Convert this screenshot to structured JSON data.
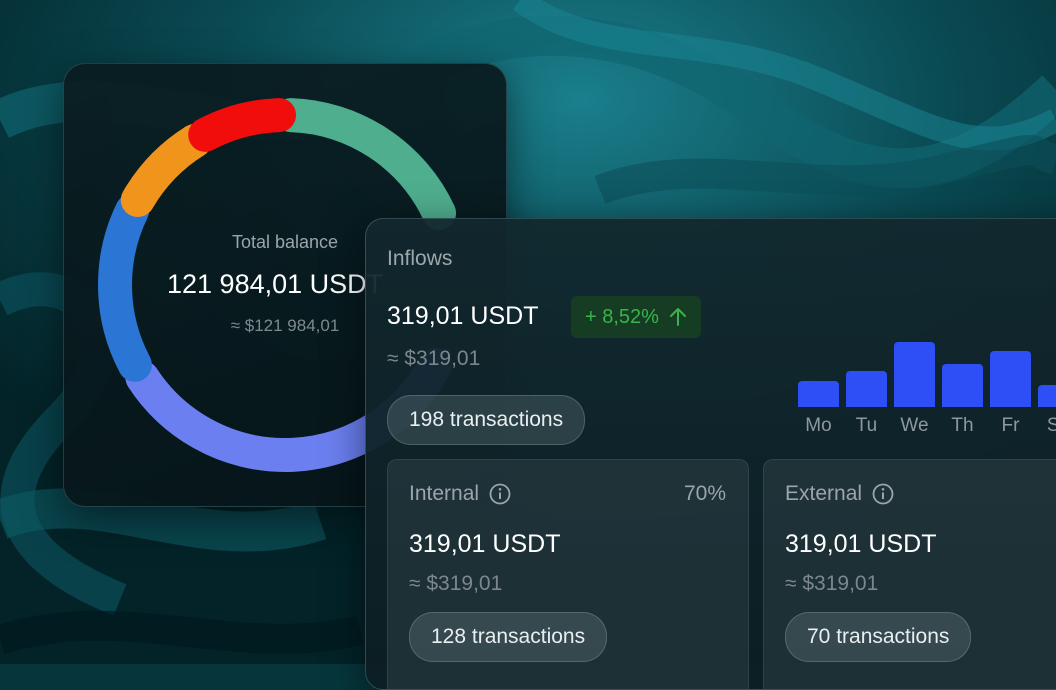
{
  "balance": {
    "label": "Total balance",
    "value": "121 984,01 USDT",
    "approx": "≈ $121 984,01",
    "segments": [
      {
        "name": "green",
        "color": "#4fae8e",
        "start": 2,
        "end": 65
      },
      {
        "name": "periwinkle",
        "color": "#6b7ff0",
        "start": 118,
        "end": 237
      },
      {
        "name": "blue",
        "color": "#2b76d4",
        "start": 242,
        "end": 296
      },
      {
        "name": "orange",
        "color": "#f0941c",
        "start": 300,
        "end": 328
      },
      {
        "name": "red",
        "color": "#f20d0d",
        "start": 332,
        "end": 358
      }
    ]
  },
  "inflows": {
    "title": "Inflows",
    "value": "319,01 USDT",
    "change": "+ 8,52%",
    "change_color": "#38b44a",
    "approx": "≈ $319,01",
    "transactions": "198 transactions",
    "bar_color": "#2d4ff5",
    "days": [
      {
        "label": "Mo",
        "value": 26
      },
      {
        "label": "Tu",
        "value": 36
      },
      {
        "label": "We",
        "value": 65
      },
      {
        "label": "Th",
        "value": 43
      },
      {
        "label": "Fr",
        "value": 56
      },
      {
        "label": "Sa",
        "value": 22
      }
    ]
  },
  "internal": {
    "title": "Internal",
    "info_icon": "info-icon",
    "percent": "70%",
    "value": "319,01 USDT",
    "approx": "≈ $319,01",
    "transactions": "128 transactions"
  },
  "external": {
    "title": "External",
    "info_icon": "info-icon",
    "value": "319,01 USDT",
    "approx": "≈ $319,01",
    "transactions": "70 transactions"
  }
}
